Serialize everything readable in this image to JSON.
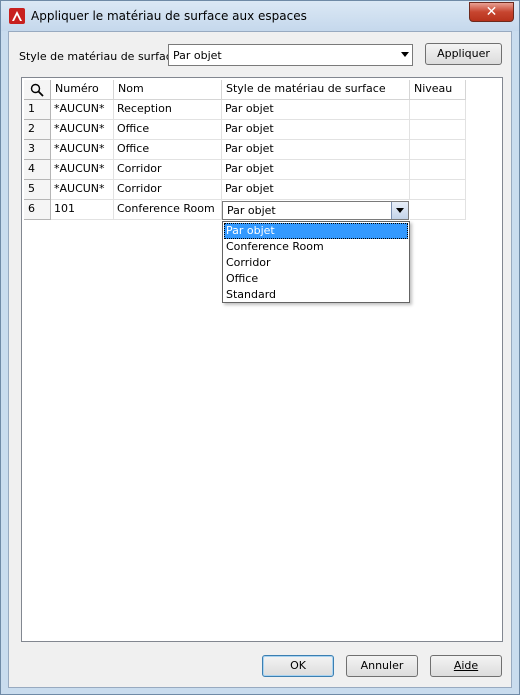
{
  "window": {
    "title": "Appliquer le matériau de surface aux espaces",
    "close_label": "✕"
  },
  "top": {
    "style_label": "Style de matériau de surface:",
    "style_value": "Par objet",
    "apply_label": "Appliquer"
  },
  "grid": {
    "headers": [
      "Numéro",
      "Nom",
      "Style de matériau de surface",
      "Niveau"
    ],
    "rows": [
      {
        "index": "1",
        "number": "*AUCUN*",
        "name": "Reception",
        "style": "Par objet",
        "level": ""
      },
      {
        "index": "2",
        "number": "*AUCUN*",
        "name": "Office",
        "style": "Par objet",
        "level": ""
      },
      {
        "index": "3",
        "number": "*AUCUN*",
        "name": "Office",
        "style": "Par objet",
        "level": ""
      },
      {
        "index": "4",
        "number": "*AUCUN*",
        "name": "Corridor",
        "style": "Par objet",
        "level": ""
      },
      {
        "index": "5",
        "number": "*AUCUN*",
        "name": "Corridor",
        "style": "Par objet",
        "level": ""
      },
      {
        "index": "6",
        "number": "101",
        "name": "Conference Room",
        "style": "Par objet",
        "level": ""
      }
    ],
    "dropdown_options": [
      "Par objet",
      "Conference Room",
      "Corridor",
      "Office",
      "Standard"
    ],
    "selected_option": "Par objet"
  },
  "buttons": {
    "ok": "OK",
    "cancel": "Annuler",
    "help": "Aide"
  }
}
